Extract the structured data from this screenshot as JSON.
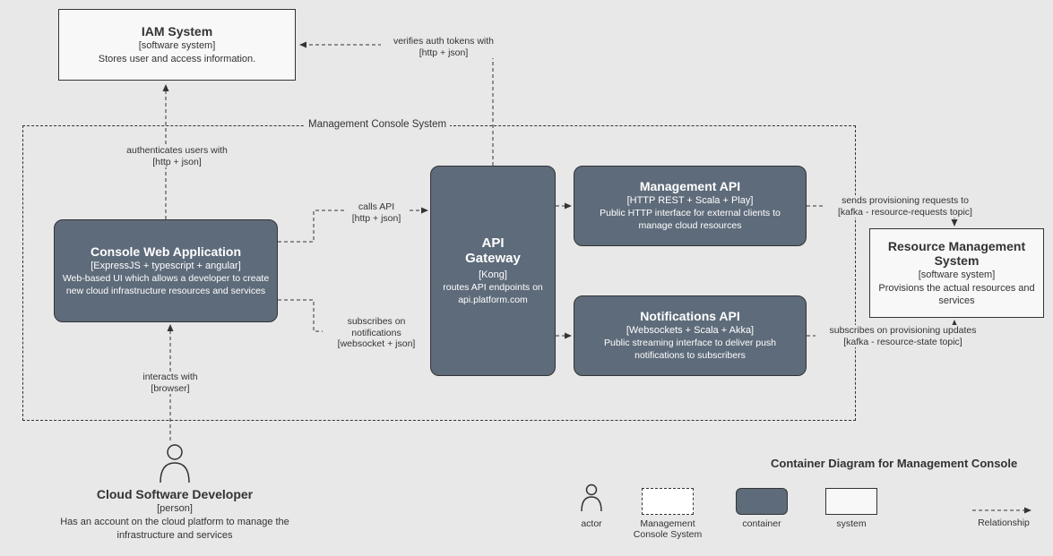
{
  "iam": {
    "title": "IAM System",
    "subtype": "[software system]",
    "desc": "Stores user and access information."
  },
  "outer": {
    "label": "Management Console System"
  },
  "console": {
    "title": "Console Web Application",
    "subtype": "[ExpressJS + typescript + angular]",
    "desc": "Web-based UI which allows a developer to create new cloud infrastructure resources and services"
  },
  "gateway": {
    "title": "API Gateway",
    "subtype": "[Kong]",
    "desc": "routes API endpoints on api.platform.com"
  },
  "mgmtapi": {
    "title": "Management API",
    "subtype": "[HTTP REST + Scala + Play]",
    "desc": "Public HTTP interface for external clients to manage cloud resources"
  },
  "notifapi": {
    "title": "Notifications API",
    "subtype": "[Websockets + Scala + Akka]",
    "desc": "Public streaming interface to deliver push notifications to subscribers"
  },
  "rms": {
    "title": "Resource Management System",
    "subtype": "[software system]",
    "desc": "Provisions the actual resources and services"
  },
  "actor": {
    "title": "Cloud Software Developer",
    "subtype": "[person]",
    "desc": "Has an account on the cloud platform to manage the infrastructure and services"
  },
  "edges": {
    "auth": {
      "l1": "authenticates users with",
      "l2": "[http + json]"
    },
    "verify": {
      "l1": "verifies auth tokens with",
      "l2": "[http + json]"
    },
    "calls": {
      "l1": "calls API",
      "l2": "[http + json]"
    },
    "subs": {
      "l1": "subscribes on notifications",
      "l2": "[websocket + json]"
    },
    "interacts": {
      "l1": "interacts with",
      "l2": "[browser]"
    },
    "sendprov": {
      "l1": "sends provisioning requests to",
      "l2": "[kafka - resource-requests topic]"
    },
    "subprov": {
      "l1": "subscribes on provisioning updates",
      "l2": "[kafka - resource-state topic]"
    }
  },
  "legend": {
    "title": "Container Diagram for Management Console",
    "actor": "actor",
    "mcs": "Management Console System",
    "container": "container",
    "system": "system",
    "rel": "Relationship"
  }
}
